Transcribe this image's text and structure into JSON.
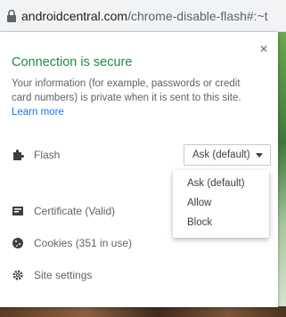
{
  "address_bar": {
    "host": "androidcentral.com",
    "path": "/chrome-disable-flash#:~t"
  },
  "popup": {
    "close_label": "×",
    "title": "Connection is secure",
    "description": "Your information (for example, passwords or credit card numbers) is private when it is sent to this site.",
    "learn_more": "Learn more",
    "flash": {
      "label": "Flash",
      "selected": "Ask (default)",
      "options": [
        "Ask (default)",
        "Allow",
        "Block"
      ]
    },
    "certificate_label": "Certificate (Valid)",
    "cookies_label": "Cookies (351 in use)",
    "site_settings_label": "Site settings"
  },
  "colors": {
    "secure_green": "#1e8e3e",
    "link_blue": "#1a73e8",
    "text_gray": "#5f6368"
  },
  "icons": [
    "lock-icon",
    "puzzle-icon",
    "certificate-icon",
    "cookie-icon",
    "gear-icon",
    "close-icon",
    "chevron-down-icon"
  ]
}
